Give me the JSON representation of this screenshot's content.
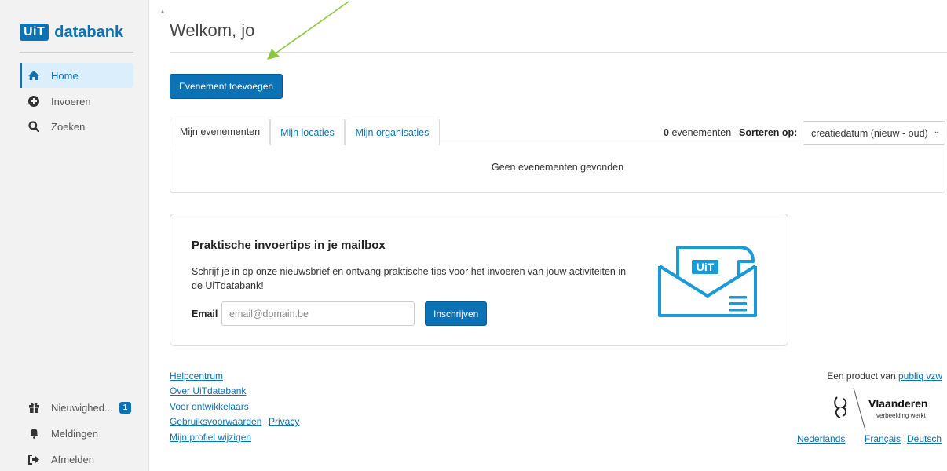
{
  "sidebar": {
    "logo_badge": "UiT",
    "logo_text": "databank",
    "items": [
      {
        "label": "Home",
        "icon": "home-icon"
      },
      {
        "label": "Invoeren",
        "icon": "plus-circle-icon"
      },
      {
        "label": "Zoeken",
        "icon": "search-icon"
      }
    ],
    "bottom_items": [
      {
        "label": "Nieuwighed...",
        "icon": "gift-icon",
        "badge": "1"
      },
      {
        "label": "Meldingen",
        "icon": "bell-icon"
      },
      {
        "label": "Afmelden",
        "icon": "sign-out-icon"
      }
    ]
  },
  "header": {
    "welcome": "Welkom, jo"
  },
  "actions": {
    "add_event": "Evenement toevoegen"
  },
  "tabs": [
    {
      "label": "Mijn evenementen",
      "active": true
    },
    {
      "label": "Mijn locaties",
      "active": false
    },
    {
      "label": "Mijn organisaties",
      "active": false
    }
  ],
  "list": {
    "count": "0",
    "count_suffix": "evenementen",
    "sort_label": "Sorteren op:",
    "sort_value": "creatiedatum (nieuw - oud)",
    "empty": "Geen evenementen gevonden"
  },
  "newsletter": {
    "title": "Praktische invoertips in je mailbox",
    "body": "Schrijf je in op onze nieuwsbrief en ontvang praktische tips voor het invoeren van jouw activiteiten in de UiTdatabank!",
    "email_label": "Email",
    "email_placeholder": "email@domain.be",
    "subscribe": "Inschrijven",
    "illustration_badge": "UiT"
  },
  "footer": {
    "links": [
      "Helpcentrum",
      "Over UiTdatabank",
      "Voor ontwikkelaars",
      "Gebruiksvoorwaarden",
      "Privacy",
      "Mijn profiel wijzigen"
    ],
    "product_prefix": "Een product van",
    "product_link": "publiq vzw",
    "gov_name": "Vlaanderen",
    "gov_tagline": "verbeelding werkt",
    "languages": [
      "Nederlands",
      "Français",
      "Deutsch"
    ]
  },
  "colors": {
    "accent": "#0b72b5",
    "annotation_arrow": "#8dc63f"
  }
}
